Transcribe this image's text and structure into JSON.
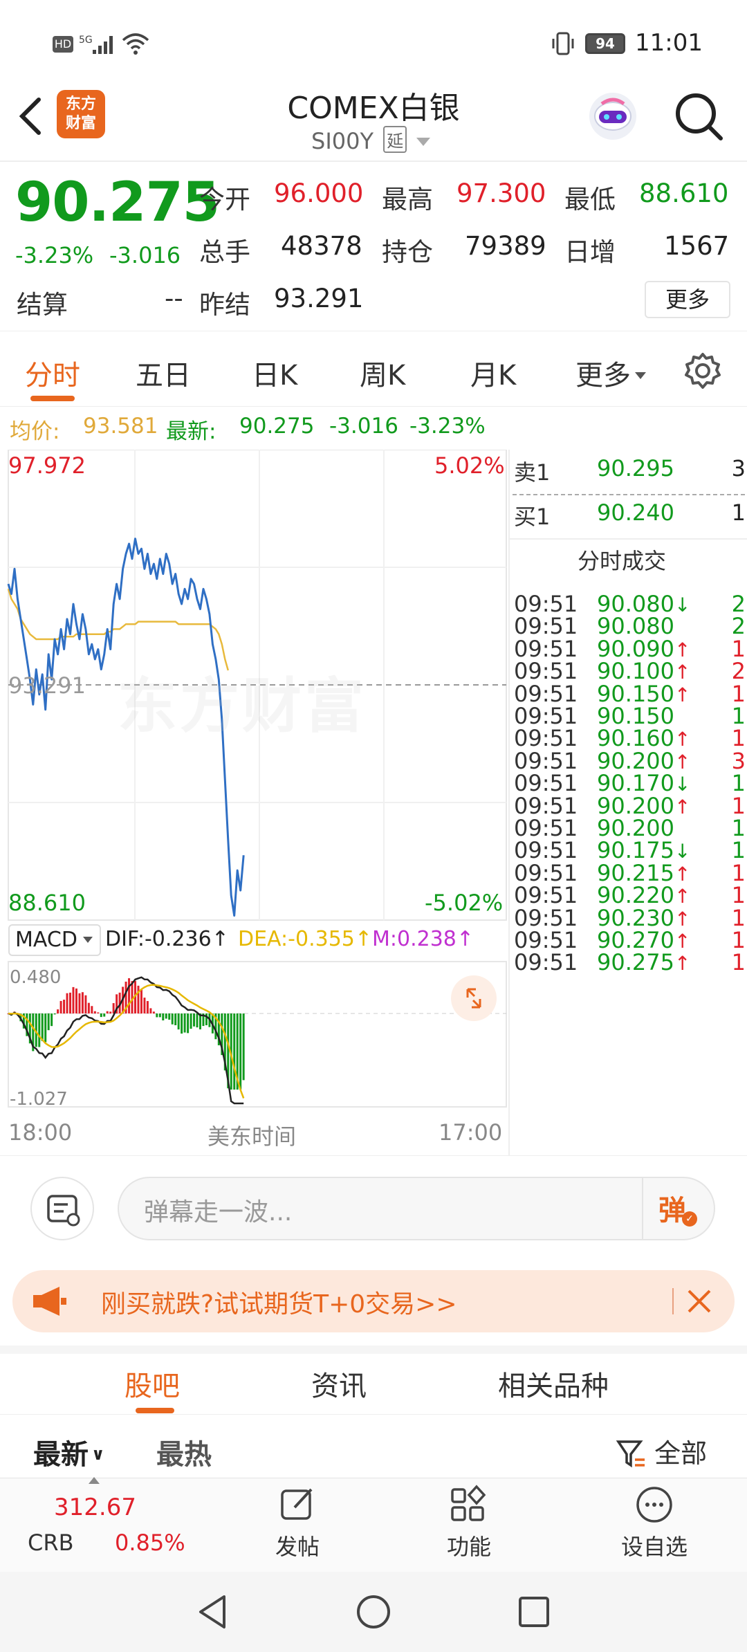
{
  "status": {
    "left_icons": [
      "hd-icon",
      "5g-signal-icon",
      "wifi-icon"
    ],
    "battery": "94",
    "time": "11:01"
  },
  "header": {
    "title": "COMEX白银",
    "code": "SI00Y",
    "delay_badge": "延",
    "logo_text_1": "东方",
    "logo_text_2": "财富"
  },
  "quote": {
    "price": "90.275",
    "change_pct": "-3.23%",
    "change": "-3.016",
    "open_label": "今开",
    "open": "96.000",
    "high_label": "最高",
    "high": "97.300",
    "low_label": "最低",
    "low": "88.610",
    "volume_label": "总手",
    "volume": "48378",
    "oi_label": "持仓",
    "oi": "79389",
    "daily_inc_label": "日增",
    "daily_inc": "1567",
    "settle_label": "结算",
    "settle": "--",
    "prev_settle_label": "昨结",
    "prev_settle": "93.291",
    "more_button": "更多"
  },
  "tabs": {
    "items": [
      "分时",
      "五日",
      "日K",
      "周K",
      "月K",
      "更多"
    ],
    "active": "分时"
  },
  "infobar": {
    "avg_label": "均价:",
    "avg": "93.581",
    "latest_label": "最新:",
    "latest": "90.275",
    "change": "-3.016",
    "change_pct": "-3.23%"
  },
  "chart": {
    "y_high": "97.972",
    "y_low": "88.610",
    "y_mid": "93.291",
    "pct_high": "5.02%",
    "pct_low": "-5.02%",
    "watermark": "东方财富",
    "indicator": "MACD",
    "dif": "DIF:-0.236",
    "dea": "DEA:-0.355",
    "m": "M:0.238",
    "macd_high": "0.480",
    "macd_low": "-1.027",
    "x_start": "18:00",
    "x_mid": "美东时间",
    "x_end": "17:00"
  },
  "chart_data": {
    "type": "line",
    "title": "",
    "ylim": [
      88.61,
      97.972
    ],
    "reference": 93.291,
    "series": [
      {
        "name": "",
        "values": [
          95.3,
          95.1,
          95.6,
          95.0,
          94.6,
          94.2,
          93.8,
          93.4,
          92.9,
          93.6,
          93.1,
          93.5,
          92.8,
          93.9,
          93.4,
          94.2,
          93.9,
          94.4,
          94.0,
          94.6,
          94.3,
          94.9,
          94.5,
          94.2,
          94.7,
          94.4,
          93.9,
          94.1,
          93.8,
          94.0,
          93.6,
          93.9,
          94.4,
          94.0,
          94.9,
          95.3,
          95.0,
          95.6,
          95.9,
          96.1,
          95.8,
          96.2,
          95.9,
          96.0,
          95.6,
          95.9,
          95.5,
          95.7,
          95.4,
          95.8,
          95.5,
          95.9,
          95.7,
          95.3,
          95.5,
          95.1,
          94.9,
          95.2,
          95.0,
          95.4,
          95.3,
          95.0,
          94.8,
          95.2,
          95.0,
          94.7,
          94.1,
          93.8,
          93.4,
          92.6,
          91.4,
          90.2,
          89.1,
          88.7,
          89.6,
          89.2,
          89.9
        ]
      },
      {
        "name": "",
        "values": [
          95.2,
          95.0,
          94.9,
          94.8,
          94.6,
          94.5,
          94.4,
          94.3,
          94.25,
          94.2,
          94.2,
          94.2,
          94.2,
          94.2,
          94.2,
          94.2,
          94.2,
          94.25,
          94.25,
          94.25,
          94.25,
          94.25,
          94.3,
          94.3,
          94.3,
          94.3,
          94.3,
          94.3,
          94.3,
          94.3,
          94.3,
          94.3,
          94.35,
          94.35,
          94.4,
          94.4,
          94.4,
          94.45,
          94.5,
          94.5,
          94.5,
          94.5,
          94.55,
          94.55,
          94.55,
          94.55,
          94.55,
          94.55,
          94.55,
          94.55,
          94.55,
          94.55,
          94.55,
          94.55,
          94.55,
          94.5,
          94.5,
          94.5,
          94.5,
          94.5,
          94.5,
          94.5,
          94.5,
          94.5,
          94.5,
          94.5,
          94.45,
          94.4,
          94.3,
          94.1,
          93.8,
          93.58
        ]
      }
    ]
  },
  "orderbook": {
    "ask_label": "卖1",
    "ask_price": "90.295",
    "ask_vol": "3",
    "bid_label": "买1",
    "bid_price": "90.240",
    "bid_vol": "1",
    "trades_title": "分时成交",
    "trades": [
      {
        "time": "09:51",
        "price": "90.080",
        "dir": "↓",
        "vol": "2"
      },
      {
        "time": "09:51",
        "price": "90.080",
        "dir": "",
        "vol": "2"
      },
      {
        "time": "09:51",
        "price": "90.090",
        "dir": "↑",
        "vol": "1"
      },
      {
        "time": "09:51",
        "price": "90.100",
        "dir": "↑",
        "vol": "2"
      },
      {
        "time": "09:51",
        "price": "90.150",
        "dir": "↑",
        "vol": "1"
      },
      {
        "time": "09:51",
        "price": "90.150",
        "dir": "",
        "vol": "1"
      },
      {
        "time": "09:51",
        "price": "90.160",
        "dir": "↑",
        "vol": "1"
      },
      {
        "time": "09:51",
        "price": "90.200",
        "dir": "↑",
        "vol": "3"
      },
      {
        "time": "09:51",
        "price": "90.170",
        "dir": "↓",
        "vol": "1"
      },
      {
        "time": "09:51",
        "price": "90.200",
        "dir": "↑",
        "vol": "1"
      },
      {
        "time": "09:51",
        "price": "90.200",
        "dir": "",
        "vol": "1"
      },
      {
        "time": "09:51",
        "price": "90.175",
        "dir": "↓",
        "vol": "1"
      },
      {
        "time": "09:51",
        "price": "90.215",
        "dir": "↑",
        "vol": "1"
      },
      {
        "time": "09:51",
        "price": "90.220",
        "dir": "↑",
        "vol": "1"
      },
      {
        "time": "09:51",
        "price": "90.230",
        "dir": "↑",
        "vol": "1"
      },
      {
        "time": "09:51",
        "price": "90.270",
        "dir": "↑",
        "vol": "1"
      },
      {
        "time": "09:51",
        "price": "90.275",
        "dir": "↑",
        "vol": "1"
      }
    ]
  },
  "chat": {
    "placeholder": "弹幕走一波...",
    "danmu_button": "弹"
  },
  "promo": {
    "text": "刚买就跌?试试期货T+0交易>>"
  },
  "sections": {
    "items": [
      "股吧",
      "资讯",
      "相关品种"
    ],
    "active": "股吧"
  },
  "filter": {
    "latest": "最新",
    "hot": "最热",
    "all": "全部"
  },
  "bottomnav": {
    "index_value": "312.67",
    "index_name": "CRB",
    "index_change": "0.85%",
    "post": "发帖",
    "functions": "功能",
    "add_watch": "设自选"
  },
  "colors": {
    "up": "#e0202a",
    "down": "#119a1d",
    "accent": "#e8661e",
    "avg_line": "#e8b93c",
    "price_line": "#2f6fc4"
  }
}
